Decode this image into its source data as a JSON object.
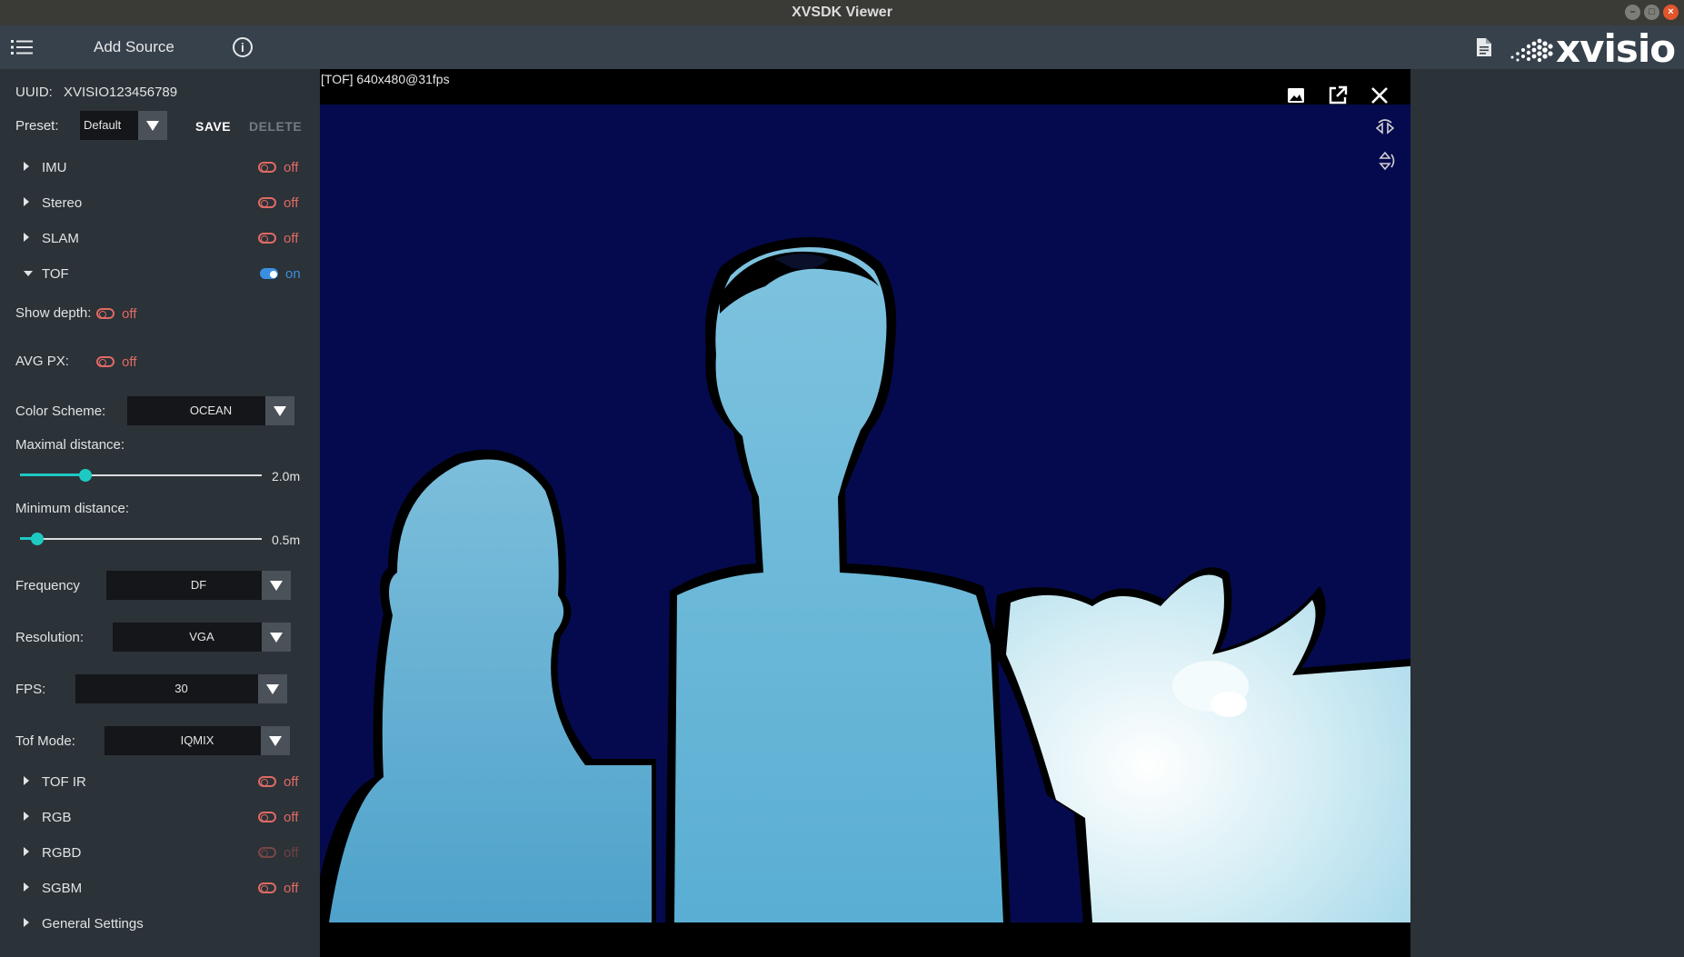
{
  "window": {
    "title": "XVSDK Viewer"
  },
  "topbar": {
    "add_source": "Add Source",
    "logo_text": "xvisio"
  },
  "device": {
    "uuid_label": "UUID:",
    "uuid_value": "XVISIO123456789"
  },
  "preset": {
    "label": "Preset:",
    "value": "Default",
    "save": "SAVE",
    "delete": "DELETE"
  },
  "sections": {
    "imu": {
      "label": "IMU",
      "state": "off"
    },
    "stereo": {
      "label": "Stereo",
      "state": "off"
    },
    "slam": {
      "label": "SLAM",
      "state": "off"
    },
    "tof": {
      "label": "TOF",
      "state": "on"
    },
    "tof_ir": {
      "label": "TOF IR",
      "state": "off"
    },
    "rgb": {
      "label": "RGB",
      "state": "off"
    },
    "rgbd": {
      "label": "RGBD",
      "state": "off"
    },
    "sgbm": {
      "label": "SGBM",
      "state": "off"
    },
    "general": {
      "label": "General Settings"
    }
  },
  "tof": {
    "show_depth": {
      "label": "Show depth:",
      "state": "off"
    },
    "avg_px": {
      "label": "AVG PX:",
      "state": "off"
    },
    "color_scheme": {
      "label": "Color Scheme:",
      "value": "OCEAN"
    },
    "max_distance": {
      "label": "Maximal distance:",
      "value": "2.0m",
      "fraction": 0.27
    },
    "min_distance": {
      "label": "Minimum distance:",
      "value": "0.5m",
      "fraction": 0.07
    },
    "frequency": {
      "label": "Frequency",
      "value": "DF"
    },
    "resolution": {
      "label": "Resolution:",
      "value": "VGA"
    },
    "fps": {
      "label": "FPS:",
      "value": "30"
    },
    "tof_mode": {
      "label": "Tof Mode:",
      "value": "IQMIX"
    }
  },
  "view": {
    "caption": "[TOF]  640x480@31fps"
  },
  "colors": {
    "accent": "#1ec9c2",
    "on": "#3b8fe0",
    "off": "#e06a64",
    "background": "#2b3238",
    "depth_bg": "#050a4e"
  },
  "icons": [
    "menu-icon",
    "info-icon",
    "document-icon",
    "image-icon",
    "open-external-icon",
    "close-icon",
    "rotate-view-icon",
    "flip-view-icon"
  ]
}
